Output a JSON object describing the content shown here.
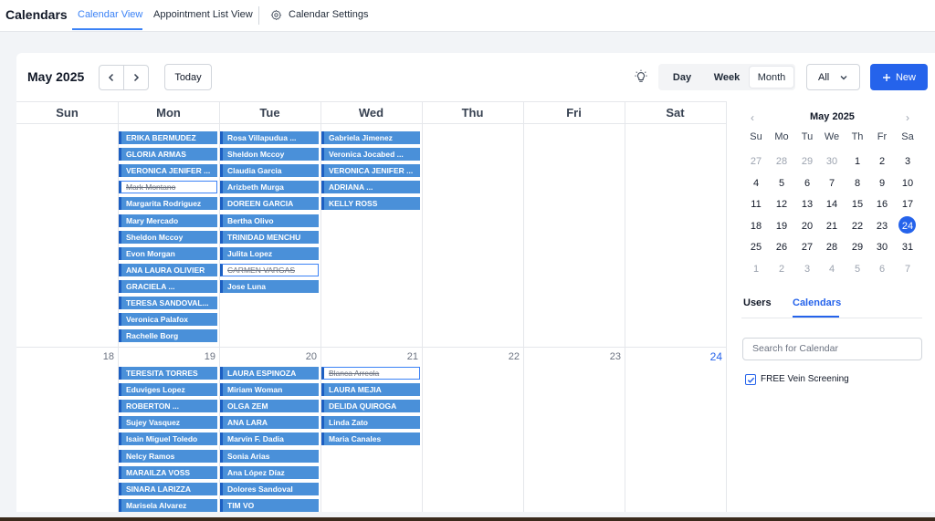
{
  "app": {
    "title": "Calendars",
    "tabs": [
      "Calendar View",
      "Appointment List View",
      "Calendar Settings"
    ]
  },
  "toolbar": {
    "month_label": "May 2025",
    "today_label": "Today",
    "views": [
      "Day",
      "Week",
      "Month"
    ],
    "filter_value": "All",
    "new_label": "New"
  },
  "grid": {
    "weekdays": [
      "Sun",
      "Mon",
      "Tue",
      "Wed",
      "Thu",
      "Fri",
      "Sat"
    ],
    "week2_days": [
      "18",
      "19",
      "20",
      "21",
      "22",
      "23",
      "24"
    ],
    "events_week1": {
      "mon": [
        {
          "name": "ERIKA BERMUDEZ",
          "cancelled": false
        },
        {
          "name": "GLORIA ARMAS",
          "cancelled": false
        },
        {
          "name": "VERONICA JENIFER ...",
          "cancelled": false
        },
        {
          "name": "Mark Montano",
          "cancelled": true
        },
        {
          "name": "Margarita Rodriguez",
          "cancelled": false
        },
        {
          "name": "Mary Mercado",
          "cancelled": false
        },
        {
          "name": "Sheldon Mccoy",
          "cancelled": false
        },
        {
          "name": "Evon Morgan",
          "cancelled": false
        },
        {
          "name": "ANA LAURA OLIVIER",
          "cancelled": false
        },
        {
          "name": "GRACIELA ...",
          "cancelled": false
        },
        {
          "name": "TERESA SANDOVAL...",
          "cancelled": false
        },
        {
          "name": "Veronica Palafox",
          "cancelled": false
        },
        {
          "name": "Rachelle Borg",
          "cancelled": false
        }
      ],
      "tue": [
        {
          "name": "Rosa Villapudua ...",
          "cancelled": false
        },
        {
          "name": "Sheldon Mccoy",
          "cancelled": false
        },
        {
          "name": "Claudia Garcia",
          "cancelled": false
        },
        {
          "name": "Arizbeth Murga",
          "cancelled": false
        },
        {
          "name": "DOREEN GARCIA",
          "cancelled": false
        },
        {
          "name": "Bertha Olivo",
          "cancelled": false
        },
        {
          "name": "TRINIDAD MENCHU",
          "cancelled": false
        },
        {
          "name": "Julita Lopez",
          "cancelled": false
        },
        {
          "name": "CARMEN VARGAS",
          "cancelled": true
        },
        {
          "name": "Jose Luna",
          "cancelled": false
        }
      ],
      "wed": [
        {
          "name": "Gabriela Jimenez",
          "cancelled": false
        },
        {
          "name": "Veronica Jocabed ...",
          "cancelled": false
        },
        {
          "name": "VERONICA JENIFER ...",
          "cancelled": false
        },
        {
          "name": "ADRIANA ...",
          "cancelled": false
        },
        {
          "name": "KELLY ROSS",
          "cancelled": false
        }
      ]
    },
    "events_week2": {
      "mon": [
        {
          "name": "TERESITA TORRES",
          "cancelled": false
        },
        {
          "name": "Eduviges Lopez",
          "cancelled": false
        },
        {
          "name": "ROBERTON ...",
          "cancelled": false
        },
        {
          "name": "Sujey Vasquez",
          "cancelled": false
        },
        {
          "name": "Isain Miguel Toledo",
          "cancelled": false
        },
        {
          "name": "Nelcy Ramos",
          "cancelled": false
        },
        {
          "name": "MARAILZA VOSS",
          "cancelled": false
        },
        {
          "name": "SINARA LARIZZA",
          "cancelled": false
        },
        {
          "name": "Marisela Alvarez",
          "cancelled": false
        }
      ],
      "tue": [
        {
          "name": "LAURA ESPINOZA",
          "cancelled": false
        },
        {
          "name": "Miriam Woman",
          "cancelled": false
        },
        {
          "name": "OLGA ZEM",
          "cancelled": false
        },
        {
          "name": "ANA LARA",
          "cancelled": false
        },
        {
          "name": "Marvin F. Dadia",
          "cancelled": false
        },
        {
          "name": "Sonia Arias",
          "cancelled": false
        },
        {
          "name": "Ana López Díaz",
          "cancelled": false
        },
        {
          "name": "Dolores Sandoval",
          "cancelled": false
        },
        {
          "name": "TIM VO",
          "cancelled": false
        }
      ],
      "wed": [
        {
          "name": "Blanca Arreola",
          "cancelled": true
        },
        {
          "name": "LAURA MEJIA",
          "cancelled": false
        },
        {
          "name": "DELIDA QUIROGA",
          "cancelled": false
        },
        {
          "name": "Linda Zato",
          "cancelled": false
        },
        {
          "name": "Maria Canales",
          "cancelled": false
        }
      ]
    }
  },
  "mini_calendar": {
    "title": "May 2025",
    "weekdays": [
      "Su",
      "Mo",
      "Tu",
      "We",
      "Th",
      "Fr",
      "Sa"
    ],
    "weeks": [
      [
        "27",
        "28",
        "29",
        "30",
        "1",
        "2",
        "3"
      ],
      [
        "4",
        "5",
        "6",
        "7",
        "8",
        "9",
        "10"
      ],
      [
        "11",
        "12",
        "13",
        "14",
        "15",
        "16",
        "17"
      ],
      [
        "18",
        "19",
        "20",
        "21",
        "22",
        "23",
        "24"
      ],
      [
        "25",
        "26",
        "27",
        "28",
        "29",
        "30",
        "31"
      ],
      [
        "1",
        "2",
        "3",
        "4",
        "5",
        "6",
        "7"
      ]
    ],
    "today": "24"
  },
  "right_panel": {
    "tabs": [
      "Users",
      "Calendars"
    ],
    "search_placeholder": "Search for Calendar",
    "calendars": [
      {
        "name": "FREE Vein Screening",
        "checked": true
      }
    ]
  },
  "colors": {
    "accent": "#2563eb",
    "event_bg": "#4a90d9",
    "event_border": "#1d5fc2"
  }
}
